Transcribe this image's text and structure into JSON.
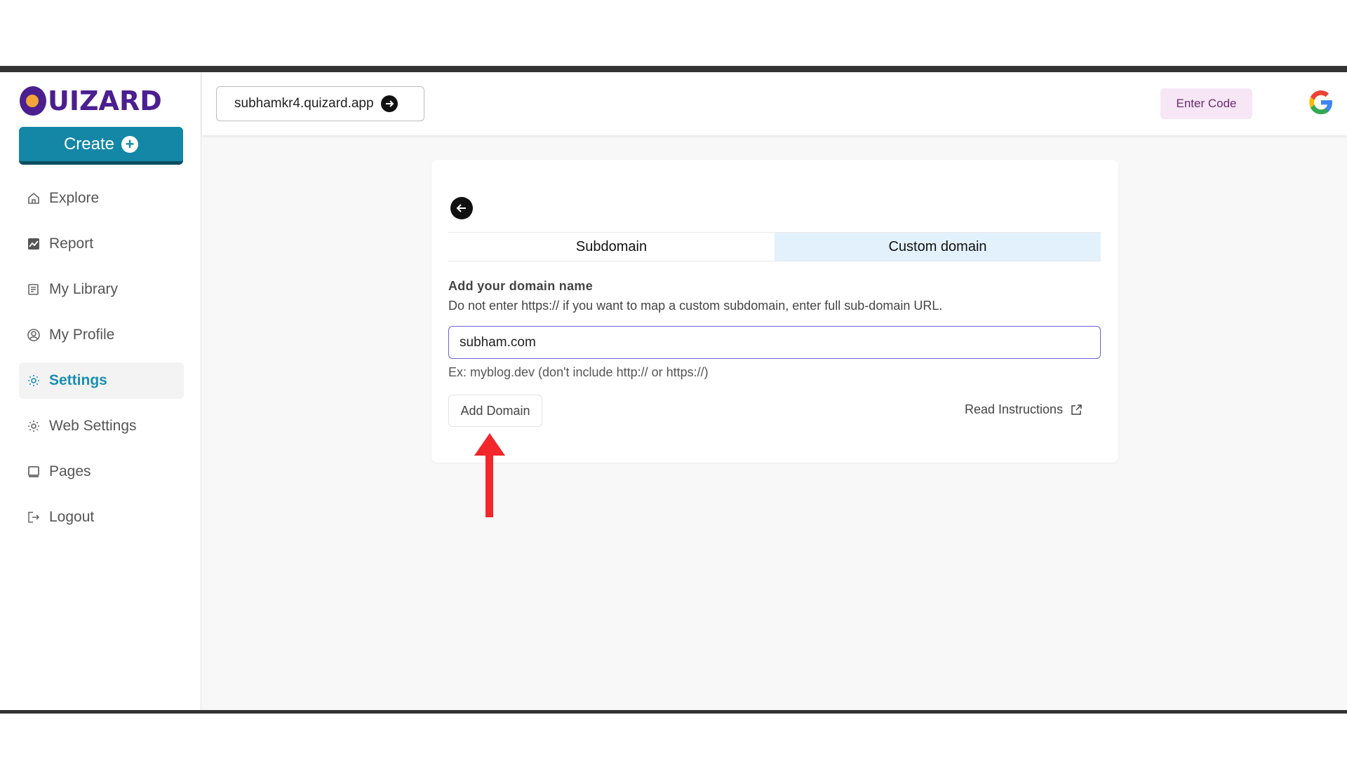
{
  "logo": {
    "text": "UIZARD"
  },
  "sidebar": {
    "create_label": "Create",
    "items": [
      {
        "label": "Explore",
        "icon": "home-icon"
      },
      {
        "label": "Report",
        "icon": "chart-icon"
      },
      {
        "label": "My Library",
        "icon": "library-icon"
      },
      {
        "label": "My Profile",
        "icon": "user-circle-icon"
      },
      {
        "label": "Settings",
        "icon": "gear-icon",
        "active": true
      },
      {
        "label": "Web Settings",
        "icon": "gear-icon"
      },
      {
        "label": "Pages",
        "icon": "pages-icon"
      },
      {
        "label": "Logout",
        "icon": "logout-icon"
      }
    ]
  },
  "header": {
    "subdomain": "subhamkr4.quizard.app",
    "enter_code": "Enter Code"
  },
  "card": {
    "tabs": [
      {
        "label": "Subdomain",
        "active": false
      },
      {
        "label": "Custom domain",
        "active": true
      }
    ],
    "title": "Add your domain name",
    "help": "Do not enter https:// if you want to map a custom subdomain, enter full sub-domain URL.",
    "input_value": "subham.com",
    "example": "Ex: myblog.dev (don't include http:// or https://)",
    "add_domain": "Add Domain",
    "read_instructions": "Read Instructions"
  },
  "colors": {
    "brand": "#4b1f8f",
    "primary": "#1487a6",
    "active_nav": "#1a8fb0",
    "tab_active_bg": "#e3f1fc",
    "input_border": "#6c63d8",
    "annotation_arrow": "#f2262b"
  }
}
